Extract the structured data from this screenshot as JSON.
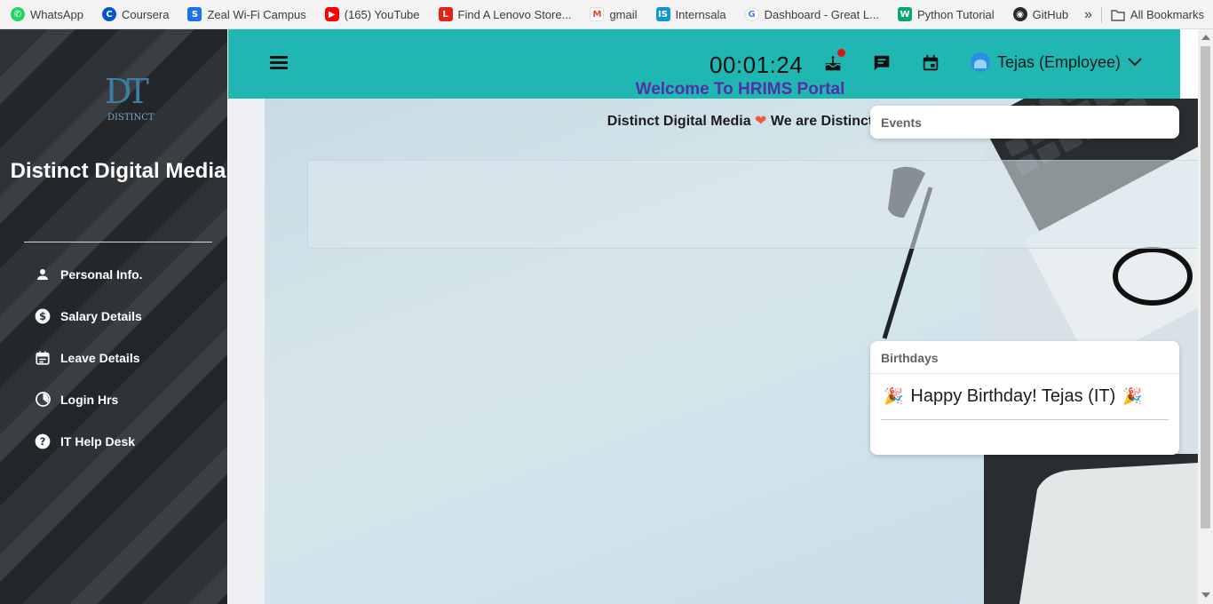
{
  "bookmarks": {
    "items": [
      {
        "label": "WhatsApp",
        "icon": "whatsapp-icon",
        "color": "#25d366"
      },
      {
        "label": "Coursera",
        "icon": "coursera-icon",
        "color": "#0056d2"
      },
      {
        "label": "Zeal Wi-Fi Campus",
        "icon": "zeal-icon",
        "color": "#1a73e8"
      },
      {
        "label": "(165) YouTube",
        "icon": "youtube-icon",
        "color": "#ff0000"
      },
      {
        "label": "Find A Lenovo Store...",
        "icon": "lenovo-icon",
        "color": "#e2231a"
      },
      {
        "label": "gmail",
        "icon": "gmail-icon",
        "color": "#ea4335"
      },
      {
        "label": "Internsala",
        "icon": "internshala-icon",
        "color": "#1295d8"
      },
      {
        "label": "Dashboard - Great L...",
        "icon": "google-icon",
        "color": "#4285f4"
      },
      {
        "label": "Python Tutorial",
        "icon": "w3schools-icon",
        "color": "#04aa6d"
      },
      {
        "label": "GitHub",
        "icon": "github-icon",
        "color": "#24292e"
      }
    ],
    "all_bookmarks": "All Bookmarks"
  },
  "sidebar": {
    "logo_monogram": "DT",
    "logo_text": "DISTINCT",
    "brand": "Distinct Digital Media",
    "items": [
      {
        "label": "Personal Info.",
        "icon": "person-icon"
      },
      {
        "label": "Salary Details",
        "icon": "dollar-icon"
      },
      {
        "label": "Leave Details",
        "icon": "calendar-icon"
      },
      {
        "label": "Login Hrs",
        "icon": "clock-icon"
      },
      {
        "label": "IT Help Desk",
        "icon": "help-icon"
      }
    ]
  },
  "topbar": {
    "timer": "00:01:24",
    "user": "Tejas (Employee)",
    "accent": "#20b7b2"
  },
  "welcome": {
    "title": "Welcome To HRIMS Portal",
    "sub_left": "Distinct Digital Media",
    "sub_right": "We are Distinct"
  },
  "events": {
    "title": "Events"
  },
  "birthdays": {
    "title": "Birthdays",
    "message": "Happy Birthday! Tejas (IT)"
  }
}
